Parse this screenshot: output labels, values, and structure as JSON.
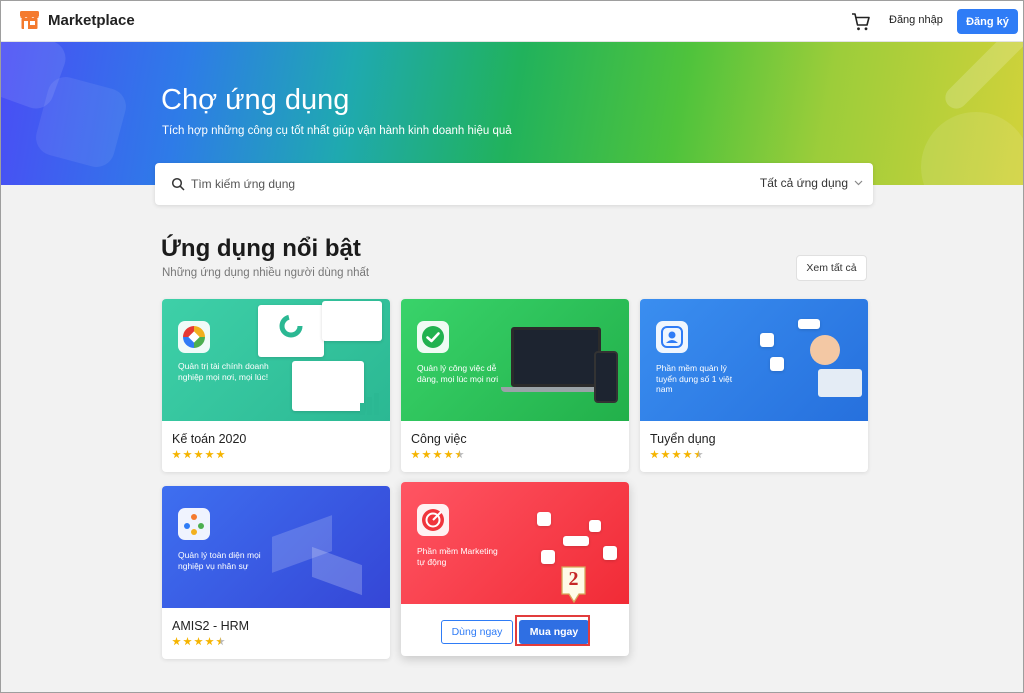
{
  "header": {
    "brand": "Marketplace",
    "login": "Đăng nhập",
    "signup": "Đăng ký",
    "icons": [
      "store-logo-icon",
      "cart-icon"
    ]
  },
  "hero": {
    "title": "Chợ ứng dụng",
    "subtitle": "Tích hợp những công cụ tốt nhất giúp vận hành kinh doanh hiệu quả"
  },
  "search": {
    "placeholder": "Tìm kiếm ứng dụng",
    "filter_label": "Tất cả ứng dụng"
  },
  "section": {
    "title": "Ứng dụng nổi bật",
    "subtitle": "Những ứng dụng nhiều người dùng nhất",
    "see_all": "Xem tất cả"
  },
  "apps": [
    {
      "name": "Kế toán 2020",
      "tagline": "Quản trị tài chính doanh nghiệp mọi nơi, mọi lúc!",
      "rating": 5,
      "color": "#35c69f"
    },
    {
      "name": "Công việc",
      "tagline": "Quản lý công việc dễ dàng, mọi lúc mọi nơi",
      "rating": 4.5,
      "color": "#2fc15a"
    },
    {
      "name": "Tuyển dụng",
      "tagline": "Phần mềm quản lý tuyển dụng số 1 việt nam",
      "rating": 4.5,
      "color": "#2f7fe6"
    },
    {
      "name": "AMIS2 - HRM",
      "tagline": "Quản lý toàn diện mọi nghiệp vụ nhân sự",
      "rating": 4.5,
      "color": "#3757e8"
    },
    {
      "name": "",
      "tagline": "Phần mềm Marketing tự động",
      "rating": null,
      "color": "#f0353c",
      "use_label": "Dùng ngay",
      "buy_label": "Mua ngay"
    }
  ],
  "annotation": {
    "step_number": "2"
  },
  "colors": {
    "primary": "#2f7cf6",
    "star": "#f5b400",
    "highlight": "#e23c3c"
  }
}
